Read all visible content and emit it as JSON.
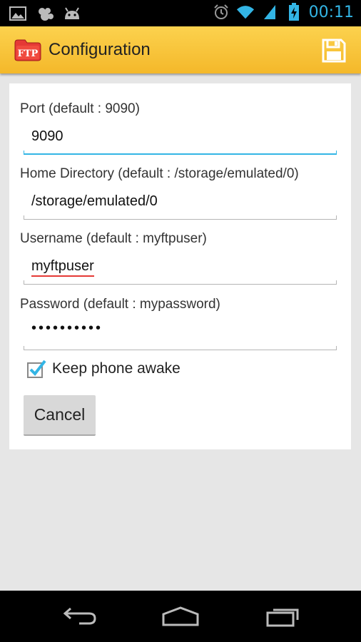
{
  "status_bar": {
    "time": "00:11",
    "left_icons": [
      "gallery-icon",
      "picasa-icon",
      "android-icon"
    ],
    "right_icons": [
      "alarm-icon",
      "wifi-icon",
      "signal-icon",
      "battery-charging-icon"
    ]
  },
  "action_bar": {
    "app_icon_text": "FTP",
    "title": "Configuration",
    "save_icon": "save-icon"
  },
  "form": {
    "port": {
      "label": "Port (default : 9090)",
      "value": "9090"
    },
    "home_directory": {
      "label": "Home Directory (default : /storage/emulated/0)",
      "value": "/storage/emulated/0"
    },
    "username": {
      "label": "Username (default : myftpuser)",
      "value": "myftpuser"
    },
    "password": {
      "label": "Password (default : mypassword)",
      "value": "••••••••••"
    },
    "keep_awake": {
      "label": "Keep phone awake",
      "checked": true
    },
    "cancel_label": "Cancel"
  },
  "nav_bar": {
    "buttons": [
      "back-icon",
      "home-icon",
      "recents-icon"
    ]
  },
  "colors": {
    "accent": "#33b5e5",
    "action_bar": "#f8c63a",
    "app_icon_red": "#e53935"
  }
}
